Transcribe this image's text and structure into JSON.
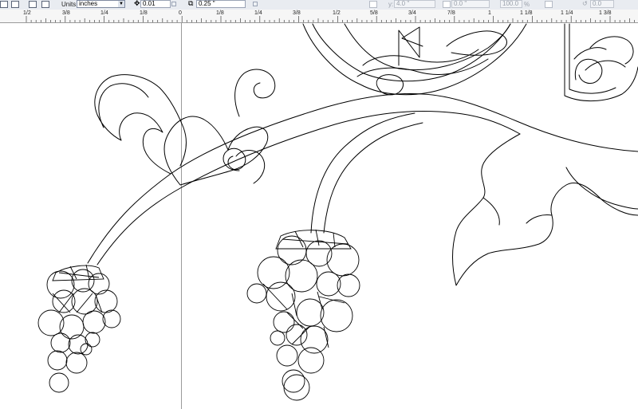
{
  "toolbar": {
    "units_label": "Units:",
    "units_value": "inches",
    "nudge_value": "0.01",
    "duplicate_value": "0.25 \"",
    "y_label": "y:",
    "y_value": "4.0 \"",
    "pos_value": "0.0 \"",
    "scale_value": "100.0",
    "scale_unit": "%",
    "angle_value": "0.0"
  },
  "ruler": {
    "labels": [
      "1/2",
      "3/8",
      "1/4",
      "1/8",
      "0",
      "1/8",
      "1/4",
      "3/8",
      "1/2",
      "5/8",
      "3/4",
      "7/8",
      "1",
      "1 1/8",
      "1 1/4",
      "1 3/8"
    ]
  },
  "colors": {
    "toolbar_bg": "#e9ecf1",
    "ruler_bg": "#f6f6f6",
    "canvas_bg": "#ffffff",
    "stroke": "#000000"
  }
}
